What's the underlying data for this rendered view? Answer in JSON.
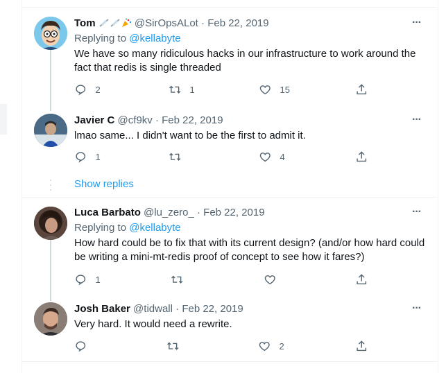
{
  "tweets": [
    {
      "name": "Tom",
      "handle": "@SirOpsALot",
      "sep": "·",
      "date": "Feb 22, 2019",
      "replying_prefix": "Replying to",
      "replying_to": "@kellabyte",
      "text": "We have so many ridiculous hacks in our infrastructure to work around the fact that redis is single threaded",
      "counts": {
        "reply": "2",
        "retweet": "1",
        "like": "15"
      },
      "name_emojis": [
        "syringe-icon",
        "syringe-icon",
        "party-popper-icon"
      ]
    },
    {
      "name": "Javier C",
      "handle": "@cf9kv",
      "sep": "·",
      "date": "Feb 22, 2019",
      "text": "lmao same... I didn't want to be the first to admit it.",
      "counts": {
        "reply": "1",
        "retweet": "",
        "like": "4"
      }
    },
    {
      "name": "Luca Barbato",
      "handle": "@lu_zero_",
      "sep": "·",
      "date": "Feb 22, 2019",
      "replying_prefix": "Replying to",
      "replying_to": "@kellabyte",
      "text": "How hard could be to fix that with its current design? (and/or how hard could be writing a mini-mt-redis proof of concept to see how it fares?)",
      "counts": {
        "reply": "1",
        "retweet": "",
        "like": ""
      }
    },
    {
      "name": "Josh Baker",
      "handle": "@tidwall",
      "sep": "·",
      "date": "Feb 22, 2019",
      "text": "Very hard. It would need a rewrite.",
      "counts": {
        "reply": "",
        "retweet": "",
        "like": "2"
      }
    }
  ],
  "show_replies": "Show replies",
  "more_label": "···",
  "colors": {
    "accent": "#1d9bf0",
    "muted": "#536471",
    "line": "#cfd9de",
    "divider": "#eff3f4"
  }
}
